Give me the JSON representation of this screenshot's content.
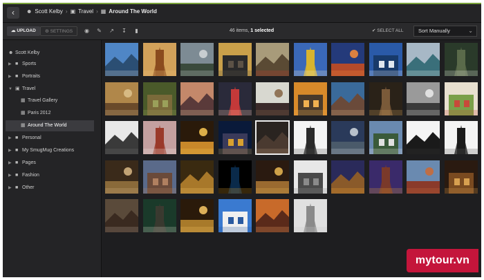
{
  "header": {
    "back_icon": "chevron-left-icon",
    "breadcrumb": [
      {
        "icon": "user-icon",
        "label": "Scott Kelby"
      },
      {
        "icon": "folder-open-icon",
        "label": "Travel"
      },
      {
        "icon": "gallery-icon",
        "label": "Around The World"
      }
    ]
  },
  "toolbar": {
    "upload_label": "UPLOAD",
    "settings_label": "SETTINGS",
    "tools": [
      "eye-icon",
      "wrench-icon",
      "share-icon",
      "download-icon",
      "trash-icon"
    ],
    "count_text": "46 items,",
    "selected_text": "1 selected",
    "select_all_label": "SELECT ALL",
    "sort_value": "Sort Manually"
  },
  "sidebar": {
    "items": [
      {
        "label": "Scott Kelby",
        "type": "root",
        "icon": "user-icon"
      },
      {
        "label": "Sports",
        "type": "folder",
        "icon": "folder-icon"
      },
      {
        "label": "Portraits",
        "type": "folder",
        "icon": "folder-icon"
      },
      {
        "label": "Travel",
        "type": "folder-open",
        "icon": "folder-open-icon"
      },
      {
        "label": "Travel Gallery",
        "type": "gallery",
        "icon": "gallery-icon"
      },
      {
        "label": "Paris 2012",
        "type": "gallery",
        "icon": "gallery-icon"
      },
      {
        "label": "Around The World",
        "type": "gallery-active",
        "icon": "gallery-icon"
      },
      {
        "label": "Personal",
        "type": "folder",
        "icon": "folder-icon"
      },
      {
        "label": "My SmugMug Creations",
        "type": "folder",
        "icon": "folder-icon"
      },
      {
        "label": "Pages",
        "type": "folder",
        "icon": "folder-icon"
      },
      {
        "label": "Fashion",
        "type": "folder",
        "icon": "folder-icon"
      },
      {
        "label": "Other",
        "type": "folder",
        "icon": "folder-icon"
      }
    ]
  },
  "thumbnails": [
    {
      "sky": "#4f86c6",
      "ground": "#2b4e73",
      "accent": "#d0d8e0"
    },
    {
      "sky": "#d2a15a",
      "ground": "#8a4b1e",
      "accent": "#f1c27a"
    },
    {
      "sky": "#7d8b94",
      "ground": "#3a4a3c",
      "accent": "#cfd4d6"
    },
    {
      "sky": "#c9a04a",
      "ground": "#2a2a2a",
      "accent": "#5c5246"
    },
    {
      "sky": "#a89b7a",
      "ground": "#5a4a34",
      "accent": "#c93a2a"
    },
    {
      "sky": "#3a68b8",
      "ground": "#d8b430",
      "accent": "#f0e8d0"
    },
    {
      "sky": "#243a7a",
      "ground": "#b44a2a",
      "accent": "#f08a3a"
    },
    {
      "sky": "#2a5aa8",
      "ground": "#183a6a",
      "accent": "#dfe6ee"
    },
    {
      "sky": "#a7b8c6",
      "ground": "#3a6f7a",
      "accent": "#e6eef0"
    },
    {
      "sky": "#2a3a2a",
      "ground": "#5a6a4a",
      "accent": "#e8e8e0"
    },
    {
      "sky": "#b0874a",
      "ground": "#6a4a2a",
      "accent": "#dcc08a"
    },
    {
      "sky": "#4a5a2a",
      "ground": "#7a6a3a",
      "accent": "#9aa05a"
    },
    {
      "sky": "#c4886a",
      "ground": "#5a3a3a",
      "accent": "#f0d0a0"
    },
    {
      "sky": "#2a2a3a",
      "ground": "#c43a3a",
      "accent": "#f0c0a0"
    },
    {
      "sky": "#d8d8d0",
      "ground": "#3a2a2a",
      "accent": "#8a6a4a"
    },
    {
      "sky": "#d88a2a",
      "ground": "#4a3a2a",
      "accent": "#f0b050"
    },
    {
      "sky": "#3a6a9a",
      "ground": "#6a4a3a",
      "accent": "#d8b080"
    },
    {
      "sky": "#2a2218",
      "ground": "#7a5a3a",
      "accent": "#c89a5a"
    },
    {
      "sky": "#9a9a9a",
      "ground": "#3a3a3a",
      "accent": "#e8e8e8"
    },
    {
      "sky": "#e8e0d0",
      "ground": "#7aa04a",
      "accent": "#c84a3a"
    },
    {
      "sky": "#e8e8e8",
      "ground": "#3a3a3a",
      "accent": "#6a6a6a"
    },
    {
      "sky": "#c4a0a0",
      "ground": "#9a3a2a",
      "accent": "#f0e8e0"
    },
    {
      "sky": "#2a1a0a",
      "ground": "#c8882a",
      "accent": "#f0c050"
    },
    {
      "sky": "#0a1a3a",
      "ground": "#3a3a5a",
      "accent": "#d8a030"
    },
    {
      "sky": "#2a2420",
      "ground": "#4a3a30",
      "accent": "#b09070"
    },
    {
      "sky": "#f4f4f4",
      "ground": "#2a2a2a",
      "accent": "#4a4a4a"
    },
    {
      "sky": "#2a3a5a",
      "ground": "#4a5a6a",
      "accent": "#c8d0d8"
    },
    {
      "sky": "#6a8ab0",
      "ground": "#3a5a3a",
      "accent": "#e0e0e0"
    },
    {
      "sky": "#f4f4f4",
      "ground": "#1a1a1a",
      "accent": "#3a3a3a"
    },
    {
      "sky": "#f4f4f4",
      "ground": "#1a1a1a",
      "accent": "#5a5a5a"
    },
    {
      "sky": "#3a2a1a",
      "ground": "#8a6a3a",
      "accent": "#d0b080"
    },
    {
      "sky": "#5a6a8a",
      "ground": "#6a4a3a",
      "accent": "#b08060"
    },
    {
      "sky": "#3a2a10",
      "ground": "#a8782a",
      "accent": "#f0c060"
    },
    {
      "sky": "#000000",
      "ground": "#0a2a4a",
      "accent": "#d89a2a"
    },
    {
      "sky": "#2a1a10",
      "ground": "#9a6a30",
      "accent": "#e0b050"
    },
    {
      "sky": "#e8e8e8",
      "ground": "#4a4a4a",
      "accent": "#8a8a8a"
    },
    {
      "sky": "#2a2a5a",
      "ground": "#8a5a2a",
      "accent": "#f0a030"
    },
    {
      "sky": "#3a2a6a",
      "ground": "#7a3a2a",
      "accent": "#e0a030"
    },
    {
      "sky": "#6a8ab0",
      "ground": "#8a3a2a",
      "accent": "#c86a3a"
    },
    {
      "sky": "#2a1a10",
      "ground": "#7a4a20",
      "accent": "#d8a050"
    },
    {
      "sky": "#5a4a3a",
      "ground": "#3a2a20",
      "accent": "#b0a090"
    },
    {
      "sky": "#1a3a2a",
      "ground": "#3a3a30",
      "accent": "#d0d0c0"
    },
    {
      "sky": "#2a1a0a",
      "ground": "#a87a2a",
      "accent": "#f0c060"
    },
    {
      "sky": "#3a7ad0",
      "ground": "#f0f0f0",
      "accent": "#2a5aa0"
    },
    {
      "sky": "#c86a2a",
      "ground": "#5a2a1a",
      "accent": "#f0a060"
    },
    {
      "sky": "#e0e0e0",
      "ground": "#8a8a8a",
      "accent": "#c8c8c8"
    }
  ],
  "watermark": {
    "text": "mytour.vn",
    "color": "#c4153b"
  }
}
